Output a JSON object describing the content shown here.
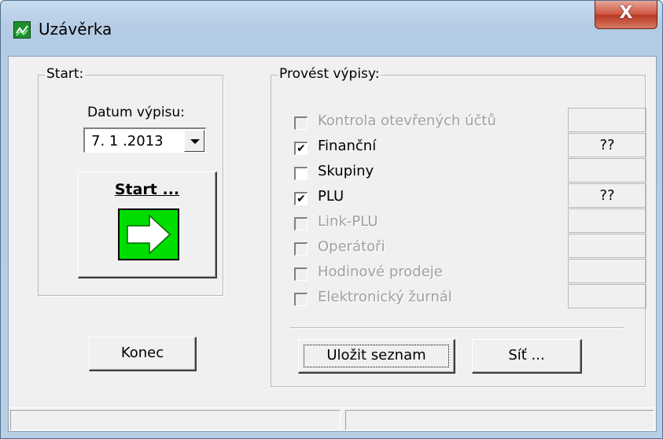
{
  "window": {
    "title": "Uzávěrka",
    "close_label": "X"
  },
  "start_group": {
    "label": "Start:",
    "date_label": "Datum výpisu:",
    "date_value": "7. 1 .2013",
    "start_button_label": "Start ...",
    "end_button_label": "Konec"
  },
  "reports_group": {
    "label": "Provést výpisy:",
    "items": [
      {
        "label": "Kontrola otevřených účtů",
        "checked": false,
        "enabled": false,
        "status": ""
      },
      {
        "label": "Finanční",
        "checked": true,
        "enabled": true,
        "status": "??"
      },
      {
        "label": "Skupiny",
        "checked": false,
        "enabled": true,
        "status": ""
      },
      {
        "label": "PLU",
        "checked": true,
        "enabled": true,
        "status": "??"
      },
      {
        "label": "Link-PLU",
        "checked": false,
        "enabled": false,
        "status": ""
      },
      {
        "label": "Operátoři",
        "checked": false,
        "enabled": false,
        "status": ""
      },
      {
        "label": "Hodinové prodeje",
        "checked": false,
        "enabled": false,
        "status": ""
      },
      {
        "label": "Elektronický žurnál",
        "checked": false,
        "enabled": false,
        "status": ""
      }
    ],
    "save_button_label": "Uložit seznam",
    "network_button_label": "Síť ..."
  },
  "statusbar": {
    "panel1": "",
    "panel2": ""
  },
  "colors": {
    "arrow_box": "#00dd00",
    "app_icon": "#1e8f2e",
    "close_button": "#c9452f"
  }
}
